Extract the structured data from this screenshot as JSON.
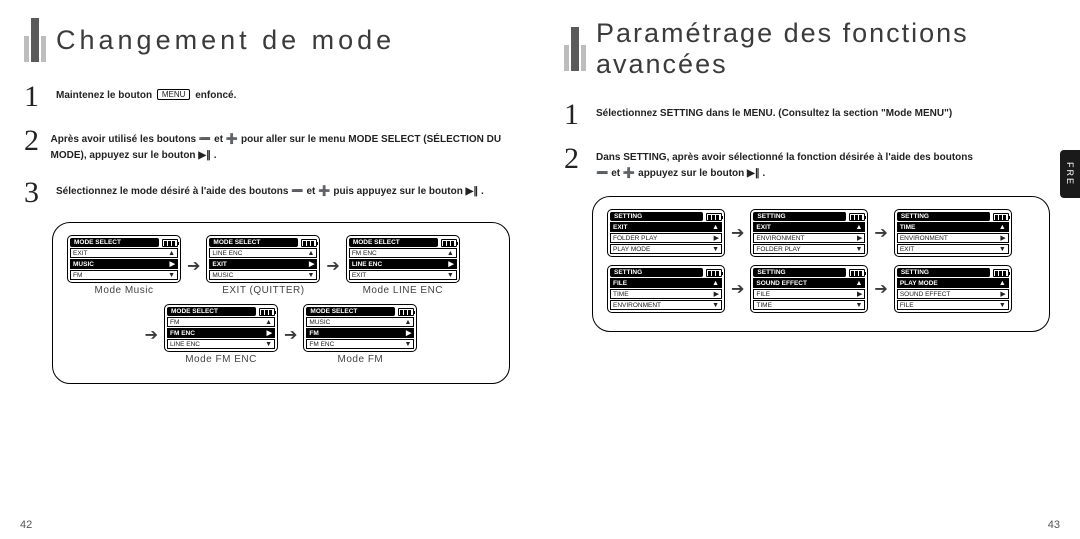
{
  "left": {
    "title": "Changement de mode",
    "steps": {
      "s1a": "Maintenez le bouton",
      "s1b": "MENU",
      "s1c": "enfoncé.",
      "s2": "Après avoir utilisé les boutons ➖ et ➕ pour aller sur le menu MODE SELECT (SÉLECTION DU MODE), appuyez sur le bouton ▶∥ .",
      "s3": "Sélectionnez le mode désiré à l'aide des boutons ➖ et ➕ puis appuyez sur le bouton ▶∥ ."
    },
    "captions": {
      "music": "Mode Music",
      "exit": "EXIT (QUITTER)",
      "lineenc": "Mode LINE ENC",
      "fmenc": "Mode FM ENC",
      "fm": "Mode FM"
    },
    "scr": {
      "title": "MODE SELECT",
      "exit": "EXIT",
      "music": "MUSIC",
      "fm": "FM",
      "lineenc": "LINE ENC",
      "fmenc": "FM ENC"
    },
    "pagenum": "42"
  },
  "right": {
    "title": "Paramétrage des fonctions avancées",
    "steps": {
      "s1": "Sélectionnez SETTING dans le MENU. (Consultez la section \"Mode MENU\")",
      "s2a": "Dans SETTING, après avoir sélectionné la fonction désirée à l'aide des boutons",
      "s2b": "➖ et ➕ appuyez sur le bouton ▶∥ ."
    },
    "scr": {
      "title": "SETTING",
      "exit": "EXIT",
      "folderplay": "FOLDER PLAY",
      "playmode": "PLAY MODE",
      "environment": "ENVIRONMENT",
      "time": "TIME",
      "file": "FILE",
      "soundeffect": "SOUND EFFECT"
    },
    "sidetab": "FRE",
    "pagenum": "43"
  }
}
